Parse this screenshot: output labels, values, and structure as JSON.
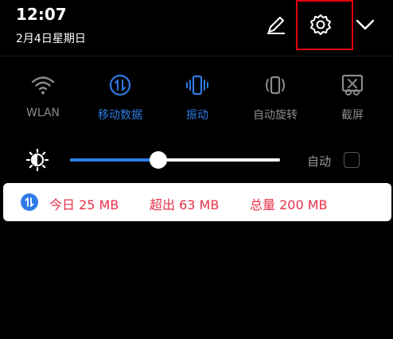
{
  "status": {
    "time": "12:07",
    "date": "2月4日星期日"
  },
  "header_icons": [
    "edit-icon",
    "settings-icon",
    "chevron-down-icon"
  ],
  "highlight_color": "#e60012",
  "accent_color": "#2e7be6",
  "alert_color": "#e8304a",
  "quick_settings": [
    {
      "label": "WLAN",
      "icon": "wifi-icon",
      "active": false
    },
    {
      "label": "移动数据",
      "icon": "mobile-data-icon",
      "active": true
    },
    {
      "label": "振动",
      "icon": "vibrate-icon",
      "active": true
    },
    {
      "label": "自动旋转",
      "icon": "auto-rotate-icon",
      "active": false
    },
    {
      "label": "截屏",
      "icon": "screenshot-icon",
      "active": false
    }
  ],
  "brightness": {
    "icon": "brightness-icon",
    "level": 0.42,
    "auto_label": "自动",
    "auto_checked": false
  },
  "data_usage": {
    "icon": "mobile-data-icon",
    "today": "今日 25 MB",
    "over": "超出 63 MB",
    "total": "总量 200 MB"
  }
}
